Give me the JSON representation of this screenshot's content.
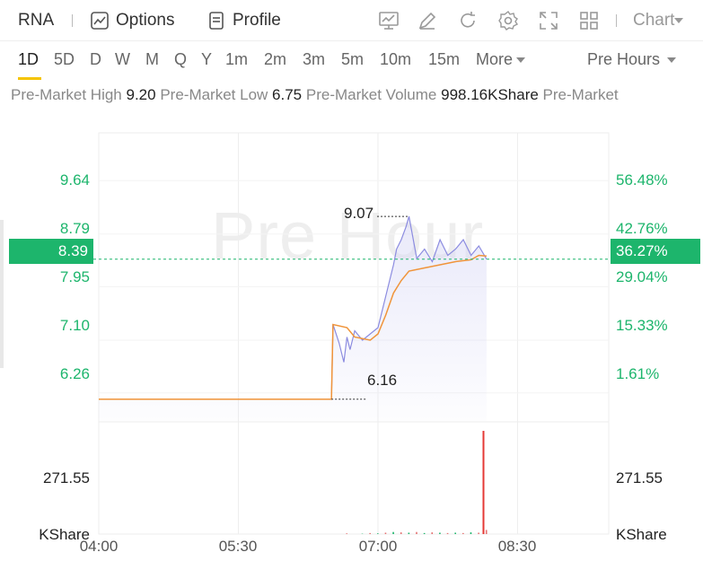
{
  "header": {
    "symbol": "RNA",
    "options_label": "Options",
    "profile_label": "Profile",
    "chart_label": "Chart"
  },
  "timeframes": {
    "items": [
      "1D",
      "5D",
      "D",
      "W",
      "M",
      "Q",
      "Y",
      "1m",
      "2m",
      "3m",
      "5m",
      "10m",
      "15m"
    ],
    "active": "1D",
    "more_label": "More",
    "session_label": "Pre Hours"
  },
  "stats": {
    "high_label": "Pre-Market High",
    "high_value": "9.20",
    "low_label": "Pre-Market Low",
    "low_value": "6.75",
    "volume_label": "Pre-Market Volume",
    "volume_value": "998.16KShare",
    "trailing_label": "Pre-Market"
  },
  "watermark": "Pre Hour",
  "colors": {
    "accent": "#f5c400",
    "up": "#1db56c",
    "price_line": "#8c8ce0",
    "avg_line": "#f0943a",
    "volume_spike": "#e53935"
  },
  "chart_data": {
    "type": "line",
    "x_ticks": [
      "04:00",
      "05:30",
      "07:00",
      "08:30"
    ],
    "y_ticks": [
      "9.64",
      "8.79",
      "7.95",
      "7.10",
      "6.26"
    ],
    "y_ticks_pct": [
      "56.48%",
      "42.76%",
      "29.04%",
      "15.33%",
      "1.61%"
    ],
    "ylim": [
      5.8,
      10.4
    ],
    "current_price": "8.39",
    "current_change": "36.27%",
    "high_annotation": "9.07",
    "low_annotation": "6.16",
    "volume_tick": "271.55",
    "volume_unit": "KShare",
    "price_series": {
      "times": [
        "04:00",
        "06:30",
        "06:31",
        "06:35",
        "06:38",
        "06:40",
        "06:42",
        "06:45",
        "06:50",
        "06:55",
        "07:00",
        "07:05",
        "07:10",
        "07:12",
        "07:15",
        "07:18",
        "07:20",
        "07:25",
        "07:30",
        "07:35",
        "07:40",
        "07:45",
        "07:50",
        "07:55",
        "08:00",
        "08:05",
        "08:10"
      ],
      "values": [
        6.16,
        6.16,
        7.35,
        7.05,
        6.75,
        7.15,
        6.95,
        7.25,
        7.1,
        7.2,
        7.3,
        7.8,
        8.3,
        8.55,
        8.7,
        8.9,
        9.07,
        8.4,
        8.55,
        8.35,
        8.7,
        8.45,
        8.55,
        8.7,
        8.45,
        8.6,
        8.39
      ]
    },
    "avg_series": {
      "times": [
        "04:00",
        "06:30",
        "06:31",
        "06:40",
        "06:45",
        "06:55",
        "07:00",
        "07:05",
        "07:10",
        "07:15",
        "07:20",
        "07:30",
        "07:40",
        "07:50",
        "08:00",
        "08:05",
        "08:10"
      ],
      "values": [
        6.16,
        6.16,
        7.35,
        7.3,
        7.15,
        7.1,
        7.2,
        7.5,
        7.85,
        8.05,
        8.2,
        8.25,
        8.3,
        8.35,
        8.38,
        8.45,
        8.44
      ]
    },
    "volume": {
      "times": [
        "06:40",
        "06:50",
        "06:55",
        "07:00",
        "07:05",
        "07:10",
        "07:15",
        "07:20",
        "07:25",
        "07:30",
        "07:35",
        "07:40",
        "07:45",
        "07:50",
        "07:55",
        "08:00",
        "08:05",
        "08:08",
        "08:10"
      ],
      "values": [
        2,
        1,
        3,
        2,
        4,
        6,
        5,
        4,
        6,
        3,
        5,
        4,
        3,
        4,
        3,
        5,
        4,
        300,
        12
      ]
    }
  }
}
